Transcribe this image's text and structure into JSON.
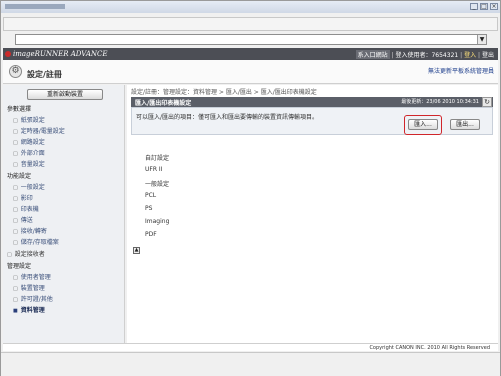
{
  "brand": {
    "name": "imageRUNNER ADVANCE"
  },
  "header": {
    "home_label": "系入口網站",
    "user_label": "登入使用者：7654321",
    "login_label": "登入",
    "logout_label": "登出"
  },
  "page": {
    "title": "設定/註冊",
    "notice": "無法更新平板系統管理員"
  },
  "sidebar": {
    "restart_label": "重新啟動裝置",
    "items": [
      {
        "label": "參數選擇",
        "kind": "head"
      },
      {
        "label": "紙張設定",
        "kind": "sub"
      },
      {
        "label": "定時器/電量設定",
        "kind": "sub"
      },
      {
        "label": "網路設定",
        "kind": "sub"
      },
      {
        "label": "外部介面",
        "kind": "sub"
      },
      {
        "label": "音量設定",
        "kind": "sub"
      },
      {
        "label": "功能設定",
        "kind": "head"
      },
      {
        "label": "一般設定",
        "kind": "sub"
      },
      {
        "label": "影印",
        "kind": "sub"
      },
      {
        "label": "印表機",
        "kind": "sub"
      },
      {
        "label": "傳送",
        "kind": "sub"
      },
      {
        "label": "接收/轉寄",
        "kind": "sub"
      },
      {
        "label": "儲存/存取檔案",
        "kind": "sub"
      },
      {
        "label": "設定接收者",
        "kind": "cat"
      },
      {
        "label": "管理設定",
        "kind": "head"
      },
      {
        "label": "使用者管理",
        "kind": "sub"
      },
      {
        "label": "裝置管理",
        "kind": "sub"
      },
      {
        "label": "許可證/其他",
        "kind": "sub"
      },
      {
        "label": "資料管理",
        "kind": "active"
      }
    ]
  },
  "main": {
    "breadcrumb": "設定/註冊：管理設定：資料管理 > 匯入/匯出 > 匯入/匯出印表機設定",
    "panel_title": "匯入/匯出印表機設定",
    "last_updated": "最後更新：23/06 2010 10:34:31",
    "description": "可以匯入/匯出的項目：僅可匯入和匯出要傳輸的裝置資訊傳輸項目。",
    "import_label": "匯入...",
    "export_label": "匯出...",
    "list_items": [
      "自訂設定",
      "UFR II",
      "一般設定",
      "PCL",
      "PS",
      "Imaging",
      "PDF"
    ]
  },
  "footer": {
    "copyright": "Copyright CANON INC. 2010 All Rights Reserved"
  },
  "colors": {
    "header_bg": "#4c4e55",
    "panel_bg": "#5b5f68",
    "highlight": "#d0262b",
    "link": "#1a3b8a"
  }
}
